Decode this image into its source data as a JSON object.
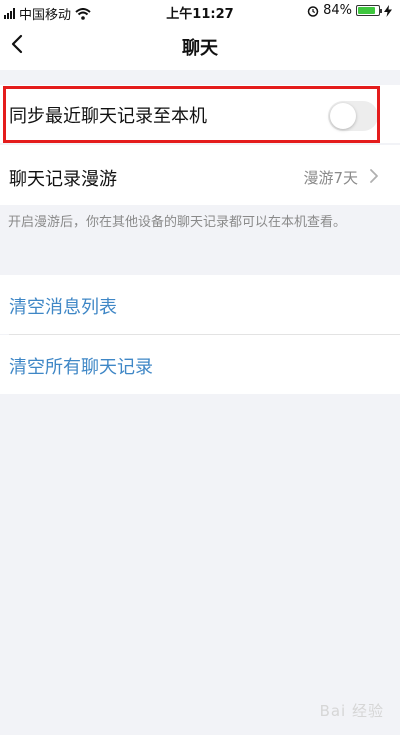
{
  "status_bar": {
    "carrier": "中国移动",
    "time": "上午11:27",
    "battery_percent": "84%",
    "battery_level": 0.84,
    "battery_color": "#3ec63e"
  },
  "nav": {
    "title": "聊天"
  },
  "settings": {
    "sync_label": "同步最近聊天记录至本机",
    "sync_enabled": false,
    "roaming_label": "聊天记录漫游",
    "roaming_value": "漫游7天",
    "hint": "开启漫游后，你在其他设备的聊天记录都可以在本机查看。",
    "clear_list_label": "清空消息列表",
    "clear_all_label": "清空所有聊天记录",
    "link_color": "#3f87c6",
    "highlight_color": "#e41c1c"
  },
  "watermark": {
    "text": "Bai 经验"
  }
}
